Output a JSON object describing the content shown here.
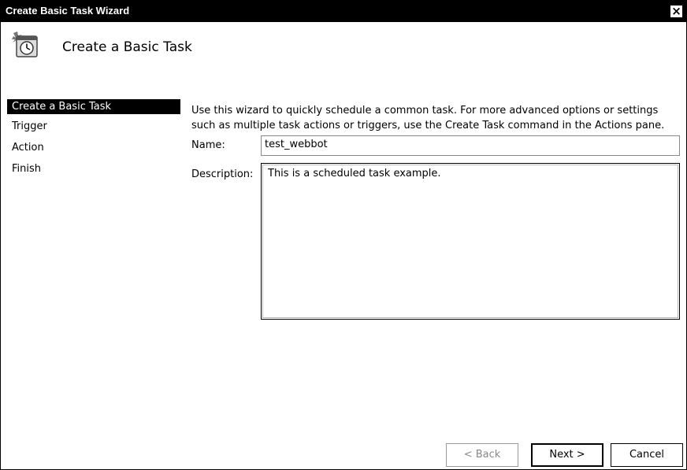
{
  "window": {
    "title": "Create Basic Task Wizard",
    "close_label": "×"
  },
  "header": {
    "title": "Create a Basic Task",
    "icon": "scheduled-task-clock-icon"
  },
  "steps": [
    {
      "label": "Create a Basic Task",
      "active": true
    },
    {
      "label": "Trigger",
      "active": false
    },
    {
      "label": "Action",
      "active": false
    },
    {
      "label": "Finish",
      "active": false
    }
  ],
  "intro": "Use this wizard to quickly schedule a common task.  For more advanced options or settings such as multiple task actions or triggers, use the Create Task command in the Actions pane.",
  "form": {
    "name_label": "Name:",
    "name_value": "test_webbot",
    "description_label": "Description:",
    "description_value": "This is a scheduled task example."
  },
  "buttons": {
    "back": "< Back",
    "next": "Next >",
    "cancel": "Cancel"
  }
}
